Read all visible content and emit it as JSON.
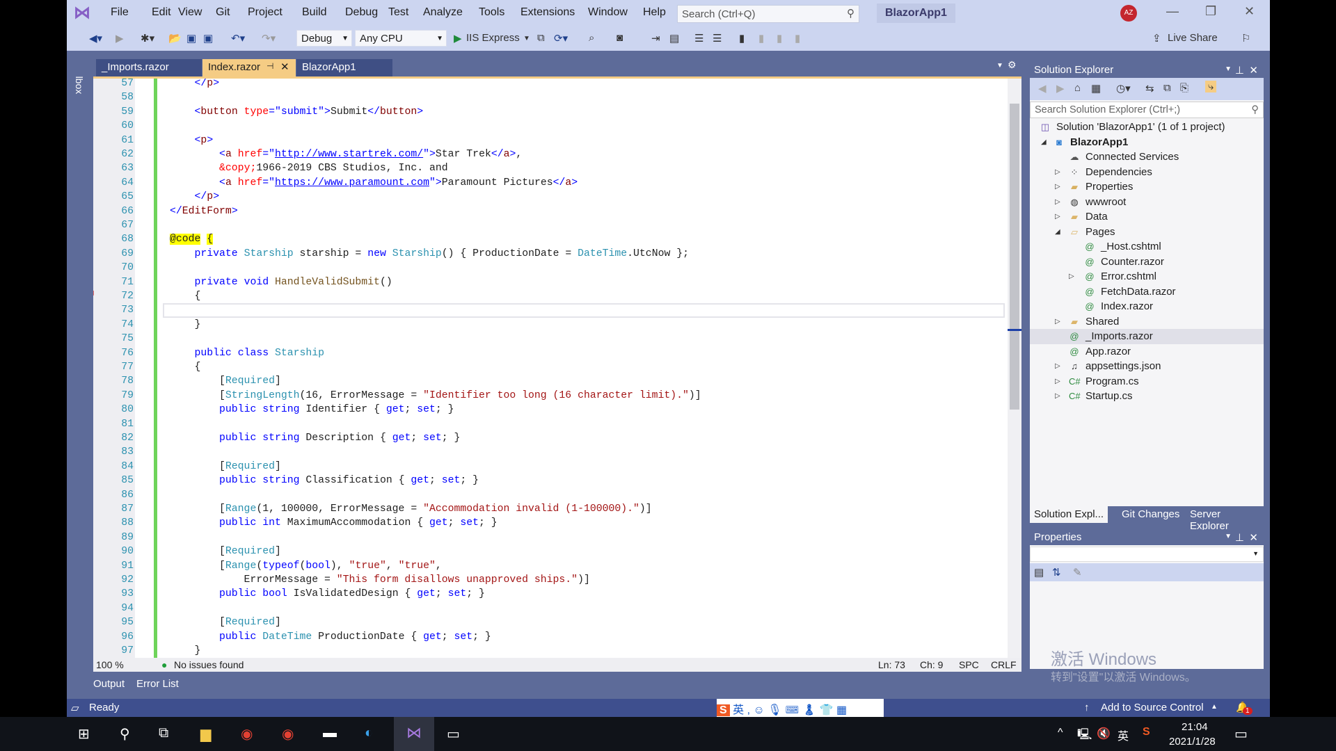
{
  "app": {
    "title": "BlazorApp1",
    "avatar": "AZ"
  },
  "menu": [
    "File",
    "Edit",
    "View",
    "Git",
    "Project",
    "Build",
    "Debug",
    "Test",
    "Analyze",
    "Tools",
    "Extensions",
    "Window",
    "Help"
  ],
  "search": {
    "placeholder": "Search (Ctrl+Q)"
  },
  "toolbar": {
    "config": "Debug",
    "platform": "Any CPU",
    "run_label": "IIS Express",
    "live_share": "Live Share"
  },
  "tabs": [
    {
      "label": "_Imports.razor",
      "active": false
    },
    {
      "label": "Index.razor",
      "active": true
    },
    {
      "label": "BlazorApp1",
      "active": false
    }
  ],
  "toolbox_label": "Toolbox",
  "editor": {
    "first_line": 57,
    "current_line": 73,
    "lines": [
      [
        [
          "    ",
          "n"
        ],
        [
          "</",
          "hs"
        ],
        [
          "p",
          "tg"
        ],
        [
          ">",
          "hs"
        ]
      ],
      [],
      [
        [
          "    ",
          "n"
        ],
        [
          "<",
          "hs"
        ],
        [
          "button ",
          "tg"
        ],
        [
          "type",
          "at"
        ],
        [
          "=\"submit\"",
          "hs"
        ],
        [
          ">",
          "hs"
        ],
        [
          "Submit",
          "n"
        ],
        [
          "</",
          "hs"
        ],
        [
          "button",
          "tg"
        ],
        [
          ">",
          "hs"
        ]
      ],
      [],
      [
        [
          "    ",
          "n"
        ],
        [
          "<",
          "hs"
        ],
        [
          "p",
          "tg"
        ],
        [
          ">",
          "hs"
        ]
      ],
      [
        [
          "        ",
          "n"
        ],
        [
          "<",
          "hs"
        ],
        [
          "a ",
          "tg"
        ],
        [
          "href",
          "at"
        ],
        [
          "=\"",
          "hs"
        ],
        [
          "http://www.startrek.com/",
          "u"
        ],
        [
          "\"",
          "hs"
        ],
        [
          ">",
          "hs"
        ],
        [
          "Star Trek",
          "n"
        ],
        [
          "</",
          "hs"
        ],
        [
          "a",
          "tg"
        ],
        [
          ">",
          "hs"
        ],
        [
          ",",
          "n"
        ]
      ],
      [
        [
          "        ",
          "n"
        ],
        [
          "&copy;",
          "at"
        ],
        [
          "1966-2019 CBS Studios, Inc. and",
          "n"
        ]
      ],
      [
        [
          "        ",
          "n"
        ],
        [
          "<",
          "hs"
        ],
        [
          "a ",
          "tg"
        ],
        [
          "href",
          "at"
        ],
        [
          "=\"",
          "hs"
        ],
        [
          "https://www.paramount.com",
          "u"
        ],
        [
          "\"",
          "hs"
        ],
        [
          ">",
          "hs"
        ],
        [
          "Paramount Pictures",
          "n"
        ],
        [
          "</",
          "hs"
        ],
        [
          "a",
          "tg"
        ],
        [
          ">",
          "hs"
        ]
      ],
      [
        [
          "    ",
          "n"
        ],
        [
          "</",
          "hs"
        ],
        [
          "p",
          "tg"
        ],
        [
          ">",
          "hs"
        ]
      ],
      [
        [
          "</",
          "hs"
        ],
        [
          "EditForm",
          "tg"
        ],
        [
          ">",
          "hs"
        ]
      ],
      [],
      [
        [
          "@code",
          "y"
        ],
        [
          " ",
          "n"
        ],
        [
          "{",
          "y"
        ]
      ],
      [
        [
          "    ",
          "n"
        ],
        [
          "private ",
          "k"
        ],
        [
          "Starship ",
          "t"
        ],
        [
          "starship = ",
          "n"
        ],
        [
          "new ",
          "k"
        ],
        [
          "Starship",
          "t"
        ],
        [
          "() { ProductionDate = ",
          "n"
        ],
        [
          "DateTime",
          "t"
        ],
        [
          ".UtcNow };",
          "n"
        ]
      ],
      [],
      [
        [
          "    ",
          "n"
        ],
        [
          "private ",
          "k"
        ],
        [
          "void ",
          "k"
        ],
        [
          "HandleValidSubmit",
          "m"
        ],
        [
          "()",
          "n"
        ]
      ],
      [
        [
          "    ",
          "n"
        ],
        [
          "{",
          "n"
        ]
      ],
      [],
      [
        [
          "    ",
          "n"
        ],
        [
          "}",
          "n"
        ]
      ],
      [],
      [
        [
          "    ",
          "n"
        ],
        [
          "public ",
          "k"
        ],
        [
          "class ",
          "k"
        ],
        [
          "Starship",
          "t"
        ]
      ],
      [
        [
          "    ",
          "n"
        ],
        [
          "{",
          "n"
        ]
      ],
      [
        [
          "        [",
          "n"
        ],
        [
          "Required",
          "t"
        ],
        [
          "]",
          "n"
        ]
      ],
      [
        [
          "        [",
          "n"
        ],
        [
          "StringLength",
          "t"
        ],
        [
          "(16, ErrorMessage = ",
          "n"
        ],
        [
          "\"Identifier too long (16 character limit).\"",
          "s"
        ],
        [
          ")]",
          "n"
        ]
      ],
      [
        [
          "        ",
          "n"
        ],
        [
          "public ",
          "k"
        ],
        [
          "string ",
          "k"
        ],
        [
          "Identifier { ",
          "n"
        ],
        [
          "get",
          "k"
        ],
        [
          "; ",
          "n"
        ],
        [
          "set",
          "k"
        ],
        [
          "; }",
          "n"
        ]
      ],
      [],
      [
        [
          "        ",
          "n"
        ],
        [
          "public ",
          "k"
        ],
        [
          "string ",
          "k"
        ],
        [
          "Description { ",
          "n"
        ],
        [
          "get",
          "k"
        ],
        [
          "; ",
          "n"
        ],
        [
          "set",
          "k"
        ],
        [
          "; }",
          "n"
        ]
      ],
      [],
      [
        [
          "        [",
          "n"
        ],
        [
          "Required",
          "t"
        ],
        [
          "]",
          "n"
        ]
      ],
      [
        [
          "        ",
          "n"
        ],
        [
          "public ",
          "k"
        ],
        [
          "string ",
          "k"
        ],
        [
          "Classification { ",
          "n"
        ],
        [
          "get",
          "k"
        ],
        [
          "; ",
          "n"
        ],
        [
          "set",
          "k"
        ],
        [
          "; }",
          "n"
        ]
      ],
      [],
      [
        [
          "        [",
          "n"
        ],
        [
          "Range",
          "t"
        ],
        [
          "(1, 100000, ErrorMessage = ",
          "n"
        ],
        [
          "\"Accommodation invalid (1-100000).\"",
          "s"
        ],
        [
          ")]",
          "n"
        ]
      ],
      [
        [
          "        ",
          "n"
        ],
        [
          "public ",
          "k"
        ],
        [
          "int ",
          "k"
        ],
        [
          "MaximumAccommodation { ",
          "n"
        ],
        [
          "get",
          "k"
        ],
        [
          "; ",
          "n"
        ],
        [
          "set",
          "k"
        ],
        [
          "; }",
          "n"
        ]
      ],
      [],
      [
        [
          "        [",
          "n"
        ],
        [
          "Required",
          "t"
        ],
        [
          "]",
          "n"
        ]
      ],
      [
        [
          "        [",
          "n"
        ],
        [
          "Range",
          "t"
        ],
        [
          "(",
          "n"
        ],
        [
          "typeof",
          "k"
        ],
        [
          "(",
          "n"
        ],
        [
          "bool",
          "k"
        ],
        [
          "), ",
          "n"
        ],
        [
          "\"true\"",
          "s"
        ],
        [
          ", ",
          "n"
        ],
        [
          "\"true\"",
          "s"
        ],
        [
          ",",
          "n"
        ]
      ],
      [
        [
          "            ErrorMessage = ",
          "n"
        ],
        [
          "\"This form disallows unapproved ships.\"",
          "s"
        ],
        [
          ")]",
          "n"
        ]
      ],
      [
        [
          "        ",
          "n"
        ],
        [
          "public ",
          "k"
        ],
        [
          "bool ",
          "k"
        ],
        [
          "IsValidatedDesign { ",
          "n"
        ],
        [
          "get",
          "k"
        ],
        [
          "; ",
          "n"
        ],
        [
          "set",
          "k"
        ],
        [
          "; }",
          "n"
        ]
      ],
      [],
      [
        [
          "        [",
          "n"
        ],
        [
          "Required",
          "t"
        ],
        [
          "]",
          "n"
        ]
      ],
      [
        [
          "        ",
          "n"
        ],
        [
          "public ",
          "k"
        ],
        [
          "DateTime ",
          "t"
        ],
        [
          "ProductionDate { ",
          "n"
        ],
        [
          "get",
          "k"
        ],
        [
          "; ",
          "n"
        ],
        [
          "set",
          "k"
        ],
        [
          "; }",
          "n"
        ]
      ],
      [
        [
          "    ",
          "n"
        ],
        [
          "}",
          "n"
        ]
      ]
    ]
  },
  "editor_status": {
    "zoom": "100 %",
    "issues": "No issues found",
    "ln": "Ln: 73",
    "ch": "Ch: 9",
    "spc": "SPC",
    "crlf": "CRLF"
  },
  "solution_explorer": {
    "title": "Solution Explorer",
    "search_placeholder": "Search Solution Explorer (Ctrl+;)",
    "items": [
      {
        "label": "Solution 'BlazorApp1' (1 of 1 project)",
        "level": 0,
        "icon": "solution-icon",
        "expander": "none"
      },
      {
        "label": "BlazorApp1",
        "level": 0,
        "icon": "project-icon",
        "expander": "expanded",
        "bold": true
      },
      {
        "label": "Connected Services",
        "level": 1,
        "icon": "cloud-icon",
        "expander": "none"
      },
      {
        "label": "Dependencies",
        "level": 1,
        "icon": "dependencies-icon",
        "expander": "collapsed"
      },
      {
        "label": "Properties",
        "level": 1,
        "icon": "properties-folder-icon",
        "expander": "collapsed"
      },
      {
        "label": "wwwroot",
        "level": 1,
        "icon": "globe-icon",
        "expander": "collapsed"
      },
      {
        "label": "Data",
        "level": 1,
        "icon": "folder-icon",
        "expander": "collapsed"
      },
      {
        "label": "Pages",
        "level": 1,
        "icon": "folder-open-icon",
        "expander": "expanded"
      },
      {
        "label": "_Host.cshtml",
        "level": 2,
        "icon": "razor-file-icon",
        "expander": "none"
      },
      {
        "label": "Counter.razor",
        "level": 2,
        "icon": "razor-file-icon",
        "expander": "none"
      },
      {
        "label": "Error.cshtml",
        "level": 2,
        "icon": "razor-file-icon",
        "expander": "collapsed"
      },
      {
        "label": "FetchData.razor",
        "level": 2,
        "icon": "razor-file-icon",
        "expander": "none"
      },
      {
        "label": "Index.razor",
        "level": 2,
        "icon": "razor-file-icon",
        "expander": "none"
      },
      {
        "label": "Shared",
        "level": 1,
        "icon": "folder-icon",
        "expander": "collapsed"
      },
      {
        "label": "_Imports.razor",
        "level": 1,
        "icon": "razor-file-icon",
        "expander": "none",
        "selected": true
      },
      {
        "label": "App.razor",
        "level": 1,
        "icon": "razor-file-icon",
        "expander": "none"
      },
      {
        "label": "appsettings.json",
        "level": 1,
        "icon": "json-file-icon",
        "expander": "collapsed"
      },
      {
        "label": "Program.cs",
        "level": 1,
        "icon": "csharp-file-icon",
        "expander": "collapsed"
      },
      {
        "label": "Startup.cs",
        "level": 1,
        "icon": "csharp-file-icon",
        "expander": "collapsed"
      }
    ],
    "bottom_tabs": [
      "Solution Expl...",
      "Git Changes",
      "Server Explorer"
    ]
  },
  "properties": {
    "title": "Properties"
  },
  "watermark": {
    "line1": "激活 Windows",
    "line2": "转到\"设置\"以激活 Windows。"
  },
  "output_tabs": [
    "Output",
    "Error List"
  ],
  "status": {
    "ready": "Ready",
    "source_control": "Add to Source Control",
    "notifications": "1"
  },
  "ime": {
    "lang": "英"
  },
  "taskbar": {
    "time": "21:04",
    "date": "2021/1/28",
    "lang": "英"
  },
  "colors": {
    "accent": "#5d6b99",
    "active_tab": "#f5cc84",
    "titlebar": "#ccd5f0",
    "statusbar": "#3e4f8e"
  }
}
